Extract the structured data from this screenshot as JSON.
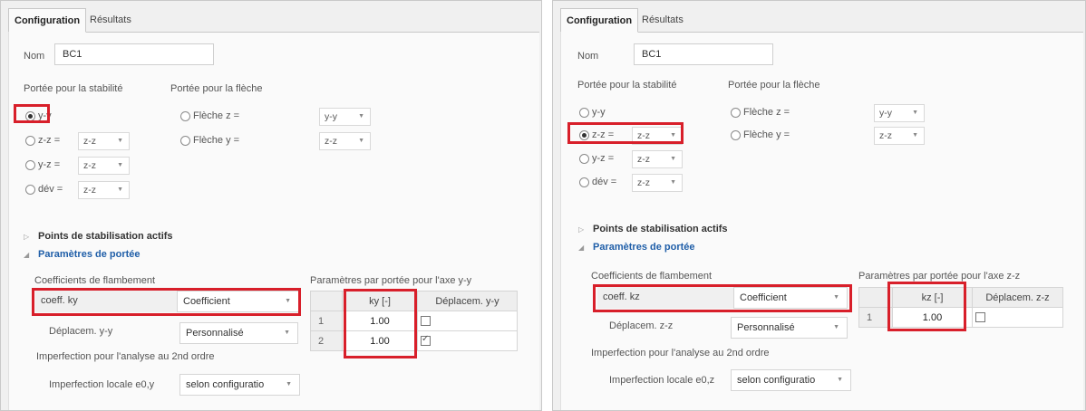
{
  "left": {
    "tabs": {
      "config": "Configuration",
      "results": "Résultats"
    },
    "name_label": "Nom",
    "name_value": "BC1",
    "stability_label": "Portée pour la stabilité",
    "deflection_label": "Portée pour la flèche",
    "stability_options": {
      "yy": "y-y",
      "zz": "z-z =",
      "yz": "y-z =",
      "dev": "dév ="
    },
    "stability_selected": "y-y",
    "stability_dropdowns": {
      "zz": "z-z",
      "yz": "z-z",
      "dev": "z-z"
    },
    "deflection_options": {
      "z": "Flèche z =",
      "y": "Flèche y ="
    },
    "deflection_dropdowns": {
      "z": "y-y",
      "y": "z-z"
    },
    "expander_points": "Points de stabilisation actifs",
    "expander_params": "Paramètres de portée",
    "buckling_title": "Coefficients de flambement",
    "coeff_label": "coeff. ky",
    "coeff_value": "Coefficient",
    "displ_label": "Déplacem. y-y",
    "displ_value": "Personnalisé",
    "imperfection_title": "Imperfection pour l'analyse au 2nd ordre",
    "imperfection_label": "Imperfection locale e0,y",
    "imperfection_value": "selon configuratio",
    "table_title": "Paramètres par portée pour l'axe y-y",
    "table_headers": {
      "coef": "ky [-]",
      "displ": "Déplacem. y-y"
    },
    "table_rows": [
      {
        "num": "1",
        "value": "1.00",
        "checked": false
      },
      {
        "num": "2",
        "value": "1.00",
        "checked": true
      }
    ]
  },
  "right": {
    "tabs": {
      "config": "Configuration",
      "results": "Résultats"
    },
    "name_label": "Nom",
    "name_value": "BC1",
    "stability_label": "Portée pour la stabilité",
    "deflection_label": "Portée pour la flèche",
    "stability_options": {
      "yy": "y-y",
      "zz": "z-z =",
      "yz": "y-z =",
      "dev": "dév ="
    },
    "stability_selected": "z-z",
    "stability_dropdowns": {
      "zz": "z-z",
      "yz": "z-z",
      "dev": "z-z"
    },
    "deflection_options": {
      "z": "Flèche z =",
      "y": "Flèche y ="
    },
    "deflection_dropdowns": {
      "z": "y-y",
      "y": "z-z"
    },
    "expander_points": "Points de stabilisation actifs",
    "expander_params": "Paramètres de portée",
    "buckling_title": "Coefficients de flambement",
    "coeff_label": "coeff. kz",
    "coeff_value": "Coefficient",
    "displ_label": "Déplacem. z-z",
    "displ_value": "Personnalisé",
    "imperfection_title": "Imperfection pour l'analyse au 2nd ordre",
    "imperfection_label": "Imperfection locale e0,z",
    "imperfection_value": "selon configuratio",
    "table_title": "Paramètres par portée pour l'axe z-z",
    "table_headers": {
      "coef": "kz [-]",
      "displ": "Déplacem. z-z"
    },
    "table_rows": [
      {
        "num": "1",
        "value": "1.00",
        "checked": false
      }
    ]
  },
  "icons": {
    "chevron_down": "▼",
    "arrow_collapsed": "▷",
    "arrow_expanded": "◢"
  },
  "colors": {
    "highlight": "#d81f2a",
    "link_blue": "#1f5ea8"
  }
}
